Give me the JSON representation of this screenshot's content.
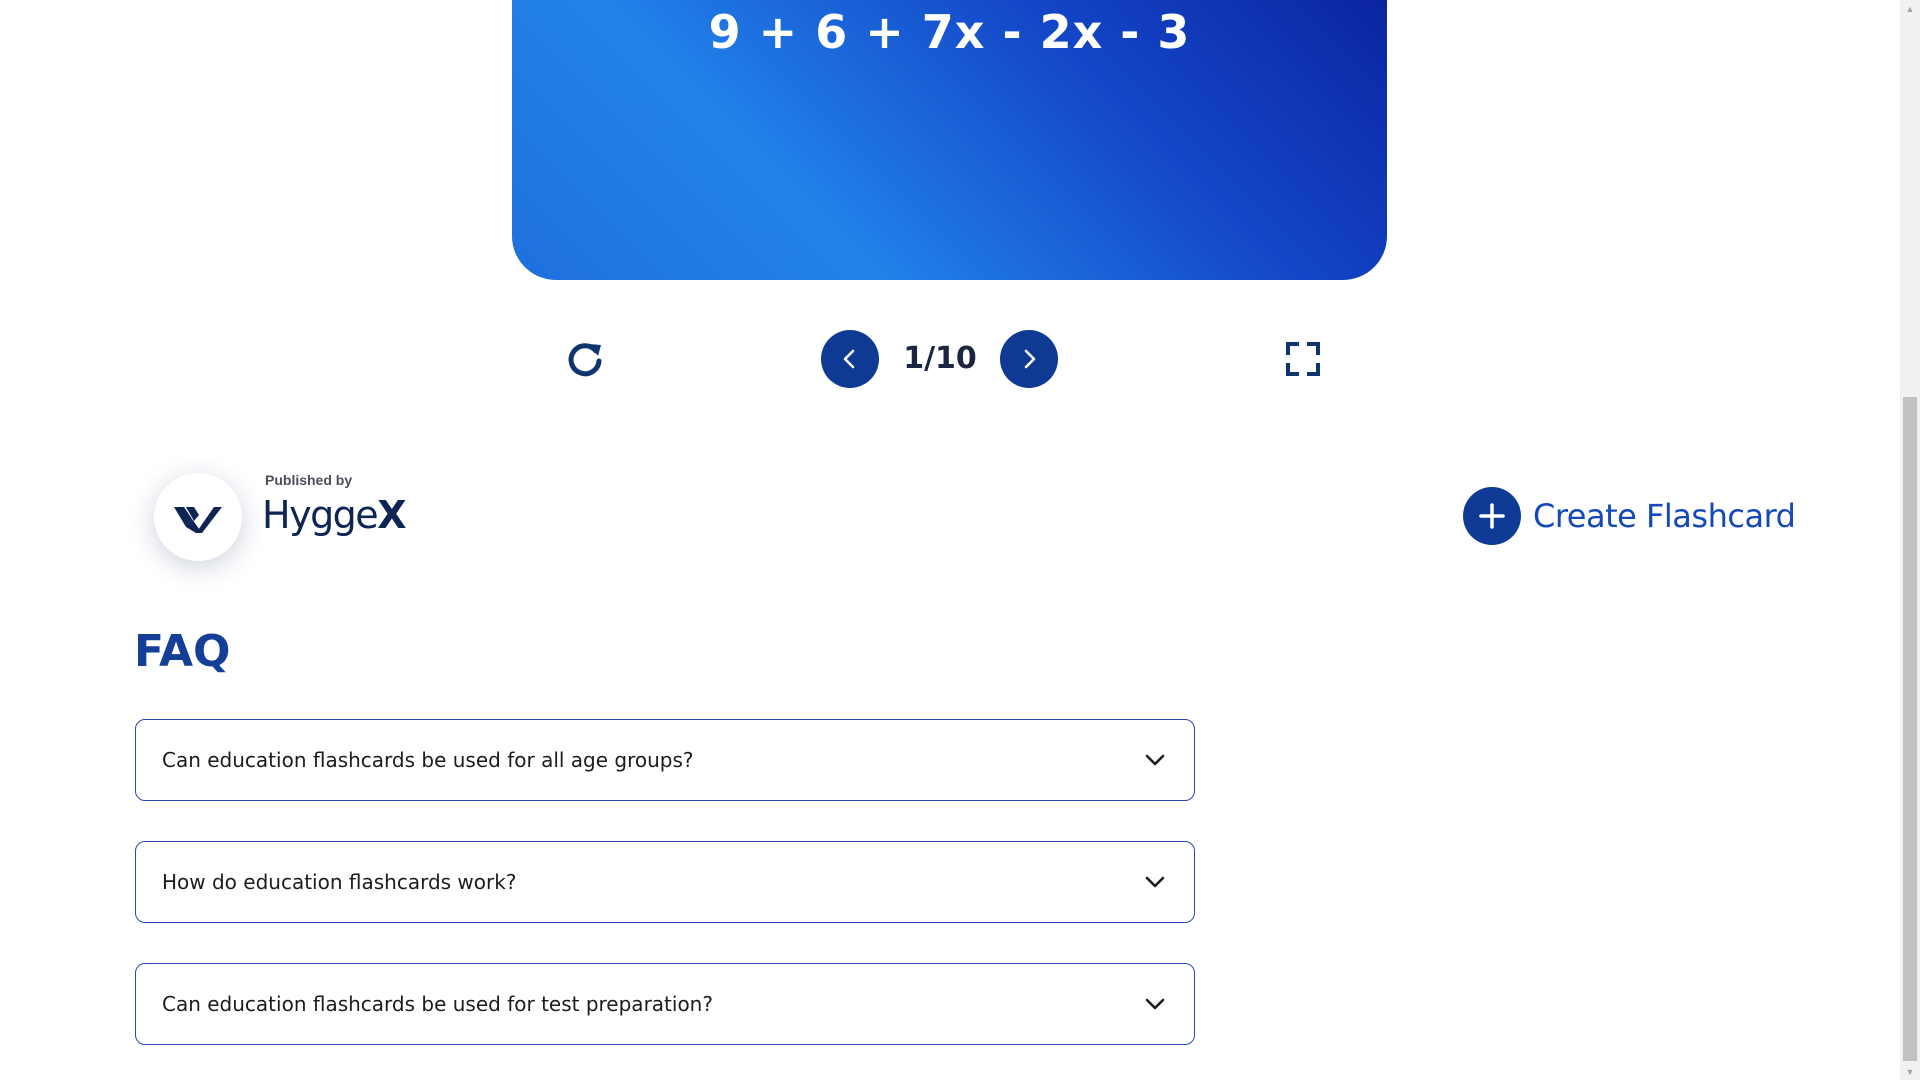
{
  "flashcard": {
    "front_text": "9 + 6 + 7x - 2x - 3"
  },
  "controls": {
    "counter": "1/10",
    "refresh_icon": "refresh-icon",
    "prev_icon": "chevron-left-icon",
    "next_icon": "chevron-right-icon",
    "fullscreen_icon": "fullscreen-icon"
  },
  "publisher": {
    "label": "Published by",
    "name_prefix": "Hygge",
    "name_suffix": "X",
    "logo_icon": "hyggex-logo"
  },
  "create": {
    "label": "Create Flashcard",
    "icon": "plus-icon"
  },
  "faq": {
    "title": "FAQ",
    "items": [
      {
        "question": "Can education flashcards be used for all age groups?"
      },
      {
        "question": "How do education flashcards work?"
      },
      {
        "question": "Can education flashcards be used for test preparation?"
      }
    ]
  },
  "colors": {
    "primary_dark": "#0f3a94",
    "primary_text": "#153e98",
    "link_blue": "#1549b8",
    "card_gradient_start": "#2283ea",
    "card_gradient_end": "#0a1f9a",
    "faq_border": "#2a47b8"
  }
}
